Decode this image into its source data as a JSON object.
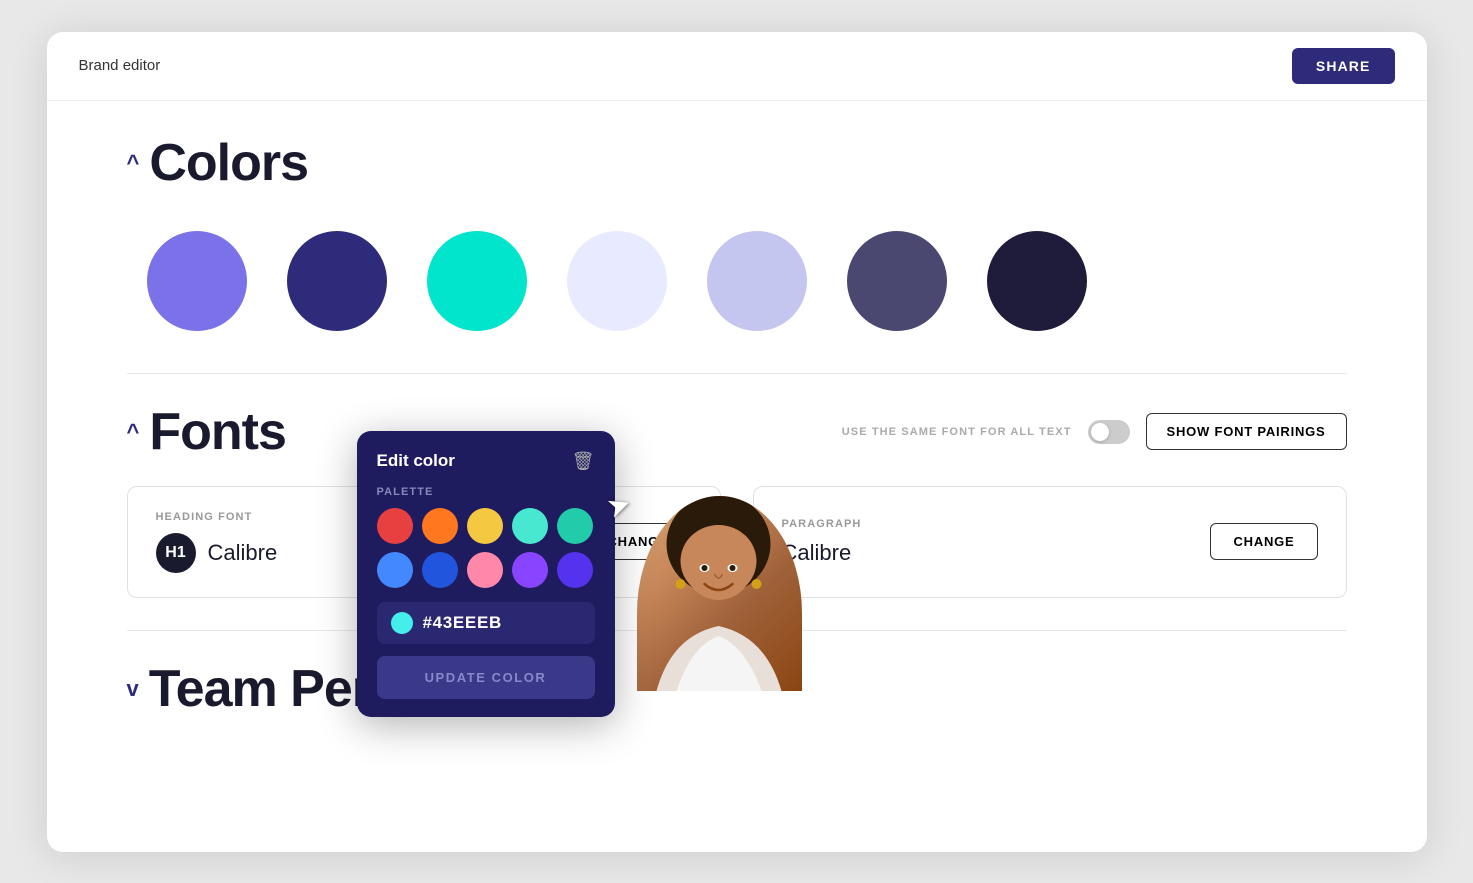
{
  "header": {
    "title": "Brand editor",
    "share_label": "SHARE"
  },
  "colors_section": {
    "chevron": "^",
    "title": "Colors",
    "circles": [
      {
        "color": "#7B72E9",
        "name": "purple-light"
      },
      {
        "color": "#2d2b7a",
        "name": "navy-dark"
      },
      {
        "color": "#00E5CC",
        "name": "cyan"
      },
      {
        "color": "#E8EAFF",
        "name": "lavender-very-light"
      },
      {
        "color": "#C4C6F0",
        "name": "lavender"
      },
      {
        "color": "#4a4870",
        "name": "slate"
      },
      {
        "color": "#1e1c3a",
        "name": "dark-navy"
      }
    ]
  },
  "fonts_section": {
    "chevron": "^",
    "title": "Fonts",
    "same_font_label": "USE THE SAME FONT FOR ALL TEXT",
    "show_pairings_label": "SHOW FONT PAIRINGS",
    "heading_card": {
      "label": "HEADING FONT",
      "icon_text": "H1",
      "font_name": "Calibre",
      "change_label": "CHANGE"
    },
    "paragraph_card": {
      "label": "PARAGRAPH",
      "font_name": "Calibre",
      "change_label": "CHANGE"
    }
  },
  "team_section": {
    "chevron": "v",
    "title": "Team Permissions"
  },
  "edit_color_popup": {
    "title": "Edit color",
    "palette_label": "PALETTE",
    "palette_colors": [
      "#E84040",
      "#FF7820",
      "#F5C842",
      "#48E8D0",
      "#22CCAA",
      "#4488FF",
      "#2255DD",
      "#FF88AA",
      "#8844FF",
      "#5533EE"
    ],
    "selected_color": "#43EEEB",
    "hex_value": "#43EEEB",
    "update_label": "UPDATE COLOR",
    "trash_icon": "🗑"
  }
}
